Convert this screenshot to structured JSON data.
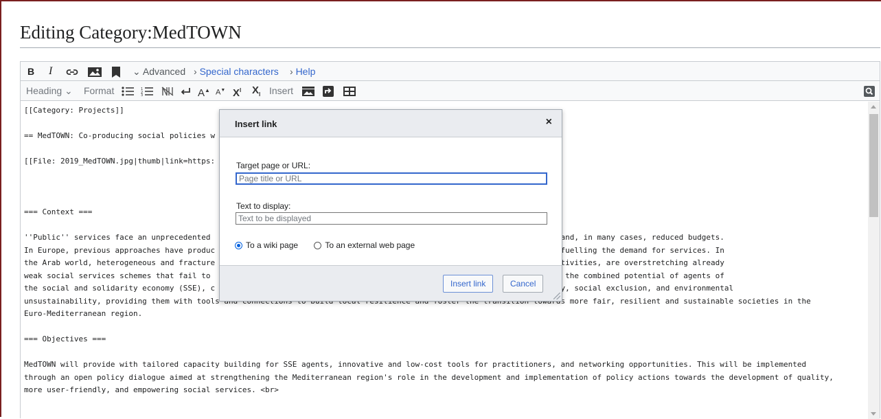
{
  "page": {
    "title": "Editing Category:MedTOWN"
  },
  "toolbar1": {
    "bold": "B",
    "italic": "I",
    "advanced": "Advanced",
    "special_characters": "Special characters",
    "help": "Help"
  },
  "toolbar2": {
    "heading": "Heading",
    "format": "Format",
    "insert": "Insert"
  },
  "editor": {
    "lines": [
      "[[Category: Projects]]",
      "",
      "== MedTOWN: Co-producing social policies w",
      "",
      "[[File: 2019_MedTOWN.jpg|thumb|link=https:",
      "",
      "",
      "",
      "=== Context ===",
      "",
      "''Public'' services face an unprecedented                                                   ractable social problems, and, in many cases, reduced budgets.",
      "In Europe, previous approaches have produc                                                  ral inequalities that are fuelling the demand for services. In",
      "the Arab world, heterogeneous and fracture                                                   industrial and service activities, are overstretching already",
      "weak social services schemes that fail to                                                  is an initiative focused on the combined potential of agents of",
      "the social and solidarity economy (SSE), c                                                  n fight poverty, inequality, social exclusion, and environmental",
      "unsustainability, providing them with tools and connections to build local resilience and foster the transition towards more fair, resilient and sustainable societies in the",
      "Euro-Mediterranean region.",
      "",
      "=== Objectives ===",
      "",
      "MedTOWN will provide with tailored capacity building for SSE agents, innovative and low-cost tools for practitioners, and networking opportunities. This will be implemented",
      "through an open policy dialogue aimed at strengthening the Mediterranean region's role in the development and implementation of policy actions towards the development of quality,",
      "more user-friendly, and empowering social services. <br>"
    ]
  },
  "dialog": {
    "title": "Insert link",
    "close": "×",
    "target_label": "Target page or URL:",
    "target_placeholder": "Page title or URL",
    "text_label": "Text to display:",
    "text_placeholder": "Text to be displayed",
    "radio_wiki": "To a wiki page",
    "radio_external": "To an external web page",
    "selected_target": "To a wiki page",
    "insert_button": "Insert link",
    "cancel_button": "Cancel"
  },
  "colors": {
    "link": "#3366cc",
    "accent_border": "#7a1f1f"
  }
}
